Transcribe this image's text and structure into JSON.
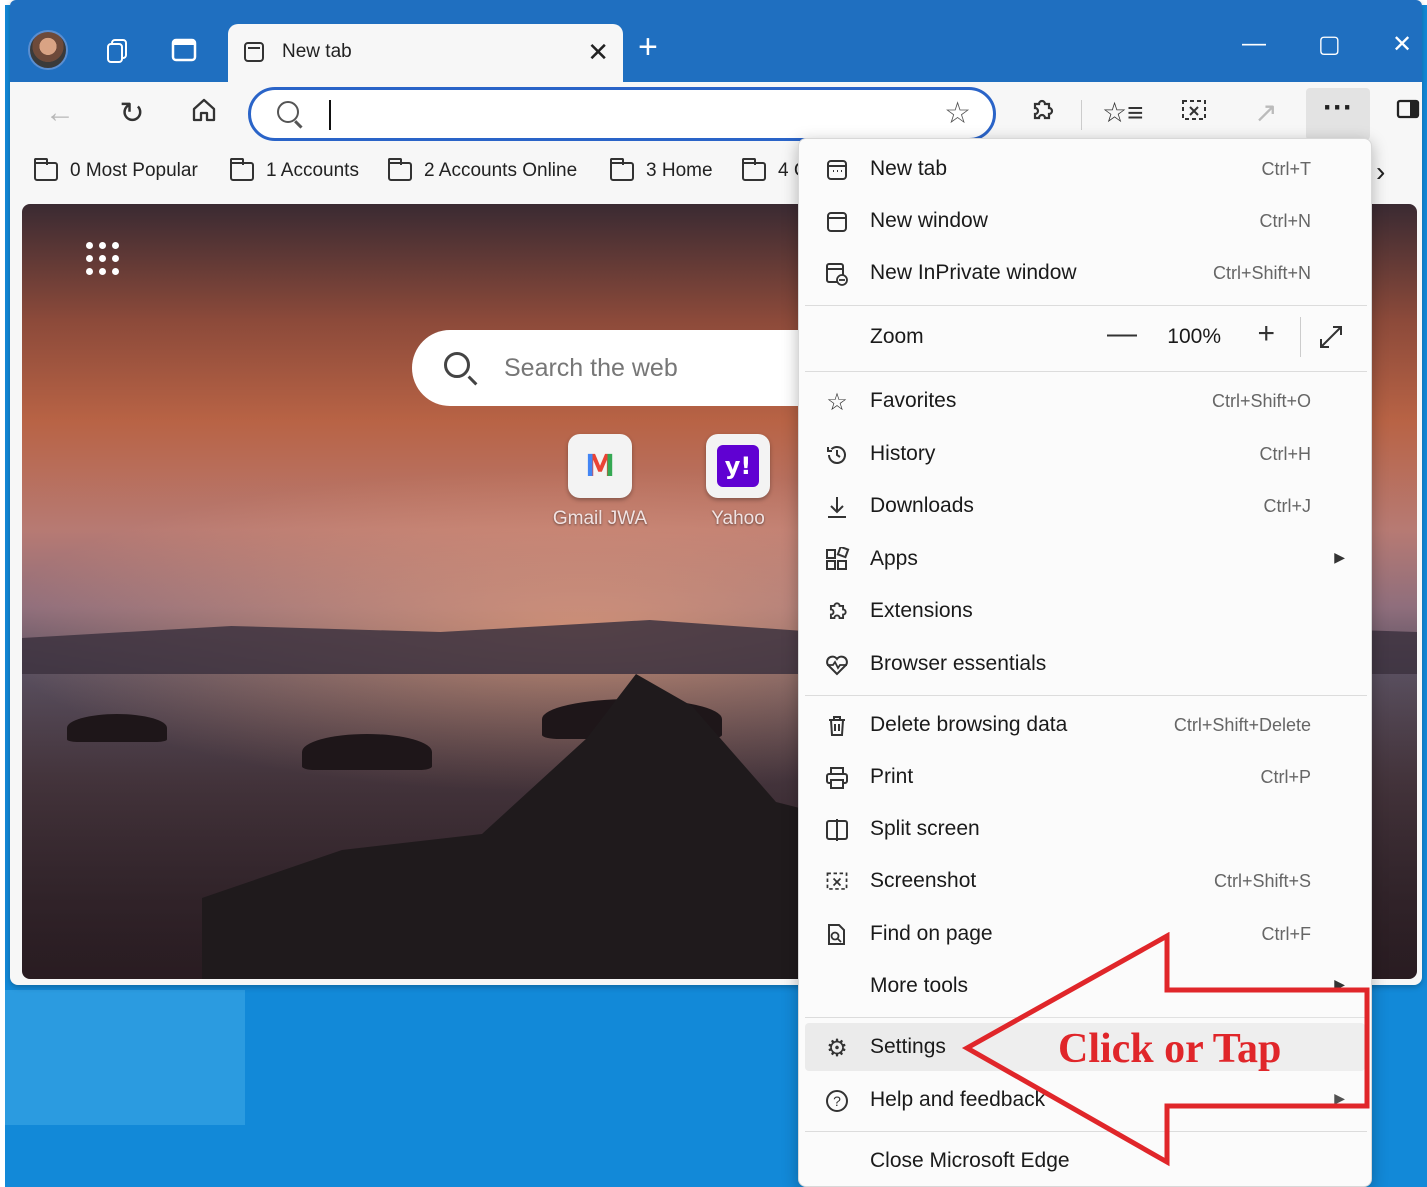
{
  "tab": {
    "title": "New tab",
    "close": "✕"
  },
  "window_controls": {
    "minimize": "—",
    "maximize": "▢",
    "close": "✕"
  },
  "favorites": [
    {
      "label": "0 Most Popular"
    },
    {
      "label": "1 Accounts"
    },
    {
      "label": "2 Accounts Online"
    },
    {
      "label": "3 Home"
    },
    {
      "label": "4 C"
    }
  ],
  "search": {
    "placeholder": "Search the web"
  },
  "tiles": [
    {
      "label": "Gmail JWA",
      "icon": "gmail-icon",
      "glyph": "M"
    },
    {
      "label": "Yahoo",
      "icon": "yahoo-icon",
      "glyph": "y!"
    }
  ],
  "menu": {
    "new_tab": {
      "label": "New tab",
      "shortcut": "Ctrl+T"
    },
    "new_window": {
      "label": "New window",
      "shortcut": "Ctrl+N"
    },
    "new_inprivate": {
      "label": "New InPrivate window",
      "shortcut": "Ctrl+Shift+N"
    },
    "zoom": {
      "label": "Zoom",
      "value": "100%",
      "minus": "—",
      "plus": "+"
    },
    "favorites": {
      "label": "Favorites",
      "shortcut": "Ctrl+Shift+O"
    },
    "history": {
      "label": "History",
      "shortcut": "Ctrl+H"
    },
    "downloads": {
      "label": "Downloads",
      "shortcut": "Ctrl+J"
    },
    "apps": {
      "label": "Apps"
    },
    "extensions": {
      "label": "Extensions"
    },
    "browser_essentials": {
      "label": "Browser essentials"
    },
    "delete_browsing_data": {
      "label": "Delete browsing data",
      "shortcut": "Ctrl+Shift+Delete"
    },
    "print": {
      "label": "Print",
      "shortcut": "Ctrl+P"
    },
    "split_screen": {
      "label": "Split screen"
    },
    "screenshot": {
      "label": "Screenshot",
      "shortcut": "Ctrl+Shift+S"
    },
    "find_on_page": {
      "label": "Find on page",
      "shortcut": "Ctrl+F"
    },
    "more_tools": {
      "label": "More tools"
    },
    "settings": {
      "label": "Settings"
    },
    "help_feedback": {
      "label": "Help and feedback"
    },
    "close_edge": {
      "label": "Close Microsoft Edge"
    }
  },
  "annotation": {
    "text": "Click or Tap",
    "color": "#e0262a"
  },
  "colors": {
    "titlebar": "#1f6fc0",
    "address_focus": "#2a64c8",
    "desktop": "#1289d8"
  }
}
